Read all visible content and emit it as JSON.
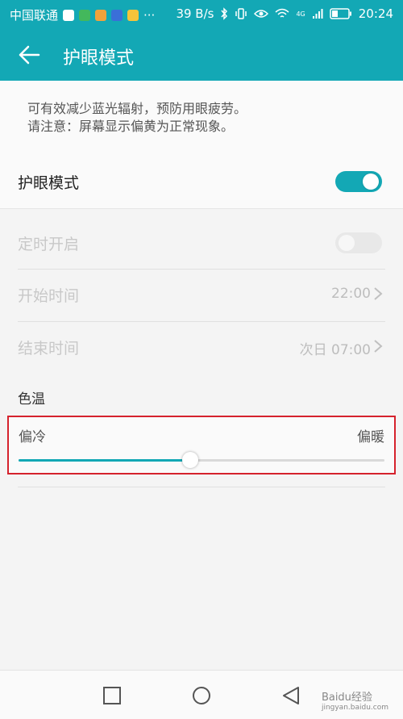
{
  "status_bar": {
    "carrier": "中国联通",
    "more": "···",
    "network_speed": "39 B/s",
    "signal_label": "4G",
    "time": "20:24"
  },
  "app_bar": {
    "title": "护眼模式"
  },
  "description": {
    "line1": "可有效减少蓝光辐射，预防用眼疲劳。",
    "line2": "请注意：屏幕显示偏黄为正常现象。"
  },
  "settings": {
    "eye_mode": {
      "label": "护眼模式",
      "enabled": true
    },
    "schedule": {
      "label": "定时开启",
      "enabled": false
    },
    "start_time": {
      "label": "开始时间",
      "value": "22:00"
    },
    "end_time": {
      "label": "结束时间",
      "value": "次日 07:00"
    }
  },
  "color_temperature": {
    "title": "色温",
    "left_label": "偏冷",
    "right_label": "偏暖",
    "level": 0.47
  },
  "watermark": {
    "text": "Baidu经验",
    "sub": "jingyan.baidu.com"
  },
  "colors": {
    "accent": "#13a8b5",
    "highlight_border": "#d5222d"
  }
}
